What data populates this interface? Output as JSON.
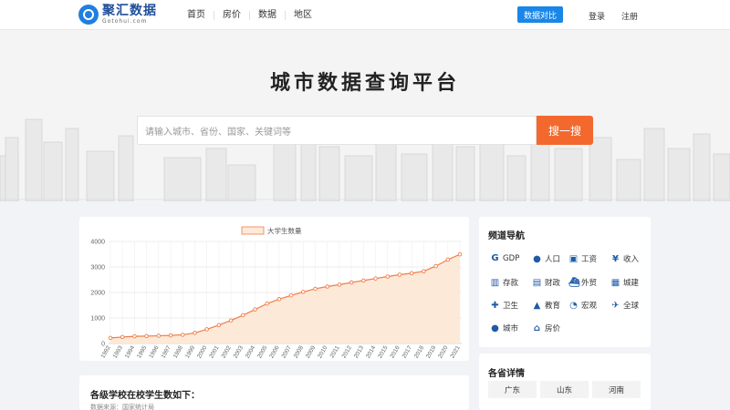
{
  "header": {
    "logo_name": "聚汇数据",
    "logo_sub": "Gotohui.com",
    "nav": [
      "首页",
      "房价",
      "数据",
      "地区"
    ],
    "compare_label": "数据对比",
    "login_label": "登录",
    "register_label": "注册"
  },
  "hero": {
    "title": "城市数据查询平台",
    "search_placeholder": "请输入城市、省份、国家、关键词等",
    "search_button": "搜一搜"
  },
  "chart_data": {
    "type": "area",
    "legend": [
      "大学生数量"
    ],
    "legend_placement": "top-center",
    "categories": [
      "1992",
      "1993",
      "1994",
      "1995",
      "1996",
      "1997",
      "1998",
      "1999",
      "2000",
      "2001",
      "2002",
      "2003",
      "2004",
      "2005",
      "2006",
      "2007",
      "2008",
      "2009",
      "2010",
      "2011",
      "2012",
      "2013",
      "2014",
      "2015",
      "2016",
      "2017",
      "2018",
      "2019",
      "2020",
      "2021"
    ],
    "series": [
      {
        "name": "大学生数量",
        "values": [
          218,
          254,
          280,
          291,
          302,
          317,
          341,
          413,
          556,
          719,
          903,
          1109,
          1334,
          1562,
          1739,
          1885,
          2021,
          2145,
          2232,
          2309,
          2391,
          2468,
          2548,
          2625,
          2696,
          2754,
          2831,
          3032,
          3285,
          3496
        ]
      }
    ],
    "ylim": [
      0,
      4000
    ],
    "yticks": [
      "0",
      "1000",
      "2000",
      "3000",
      "4000"
    ],
    "grid": true,
    "line_color": "#f07d4a",
    "fill_color": "#fde9d8"
  },
  "info": {
    "title": "各级学校在校学生数如下：",
    "source": "数据来源：国家统计局"
  },
  "side": {
    "title": "频道导航",
    "channels": [
      {
        "label": "GDP",
        "icon": "g-icon"
      },
      {
        "label": "人口",
        "icon": "person-icon"
      },
      {
        "label": "工资",
        "icon": "money-icon"
      },
      {
        "label": "收入",
        "icon": "yen-icon"
      },
      {
        "label": "存款",
        "icon": "bank-icon"
      },
      {
        "label": "财政",
        "icon": "doc-icon"
      },
      {
        "label": "外贸",
        "icon": "ship-icon"
      },
      {
        "label": "城建",
        "icon": "train-icon"
      },
      {
        "label": "卫生",
        "icon": "medkit-icon"
      },
      {
        "label": "教育",
        "icon": "cap-icon"
      },
      {
        "label": "宏观",
        "icon": "pie-icon"
      },
      {
        "label": "全球",
        "icon": "plane-icon"
      },
      {
        "label": "城市",
        "icon": "pin-icon"
      },
      {
        "label": "房价",
        "icon": "home-icon"
      }
    ]
  },
  "provinces": {
    "title": "各省详情",
    "items": [
      "广东",
      "山东",
      "河南"
    ]
  }
}
